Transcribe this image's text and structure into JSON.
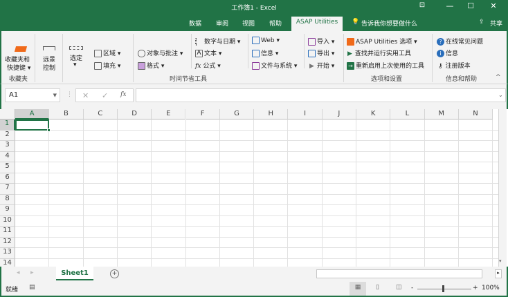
{
  "window": {
    "title": "工作簿1  -  Excel",
    "minimize": "—",
    "maximize": "☐",
    "close": "✕",
    "ribbon_display": "⊡"
  },
  "tabs": [
    "数据",
    "审阅",
    "视图",
    "帮助",
    "ASAP Utilities"
  ],
  "tell_me": "告诉我你想要做什么",
  "share": "共享",
  "ribbon": {
    "fav": {
      "label1": "收藏夹和",
      "label2": "快捷键 ▾",
      "group": "收藏夹"
    },
    "remote": {
      "label1": "远景",
      "label2": "控制"
    },
    "select": {
      "label1": "选定",
      "label2": "▾"
    },
    "range": "区域 ▾",
    "fill": "填充 ▾",
    "objects": "对象与批注 ▾",
    "format": "格式 ▾",
    "numbers": "数字与日期 ▾",
    "text": "文本 ▾",
    "formulas": "公式 ▾",
    "web": "Web ▾",
    "info": "信息 ▾",
    "files": "文件与系统 ▾",
    "import": "导入 ▾",
    "export": "导出 ▾",
    "start": "开始 ▾",
    "time_group": "时间节省工具",
    "asap_options": "ASAP Utilities 选项 ▾",
    "find_run": "查找并运行实用工具",
    "restart_last": "重新启用上次使用的工具",
    "options_group": "选项和设置",
    "faq": "在线常见问题",
    "info2": "信息",
    "register": "注册版本",
    "help_group": "信息和帮助",
    "collapse": "^"
  },
  "formula_bar": {
    "name_box": "A1",
    "cancel": "✕",
    "enter": "✓",
    "fx": "fx",
    "value": ""
  },
  "columns": [
    "A",
    "B",
    "C",
    "D",
    "E",
    "F",
    "G",
    "H",
    "I",
    "J",
    "K",
    "L",
    "M",
    "N"
  ],
  "rows": [
    "1",
    "2",
    "3",
    "4",
    "5",
    "6",
    "7",
    "8",
    "9",
    "10",
    "11",
    "12",
    "13",
    "14"
  ],
  "sheet_tab": "Sheet1",
  "add_sheet": "+",
  "status": {
    "ready": "就绪",
    "zoom_minus": "-",
    "zoom_plus": "+",
    "zoom": "100%"
  }
}
